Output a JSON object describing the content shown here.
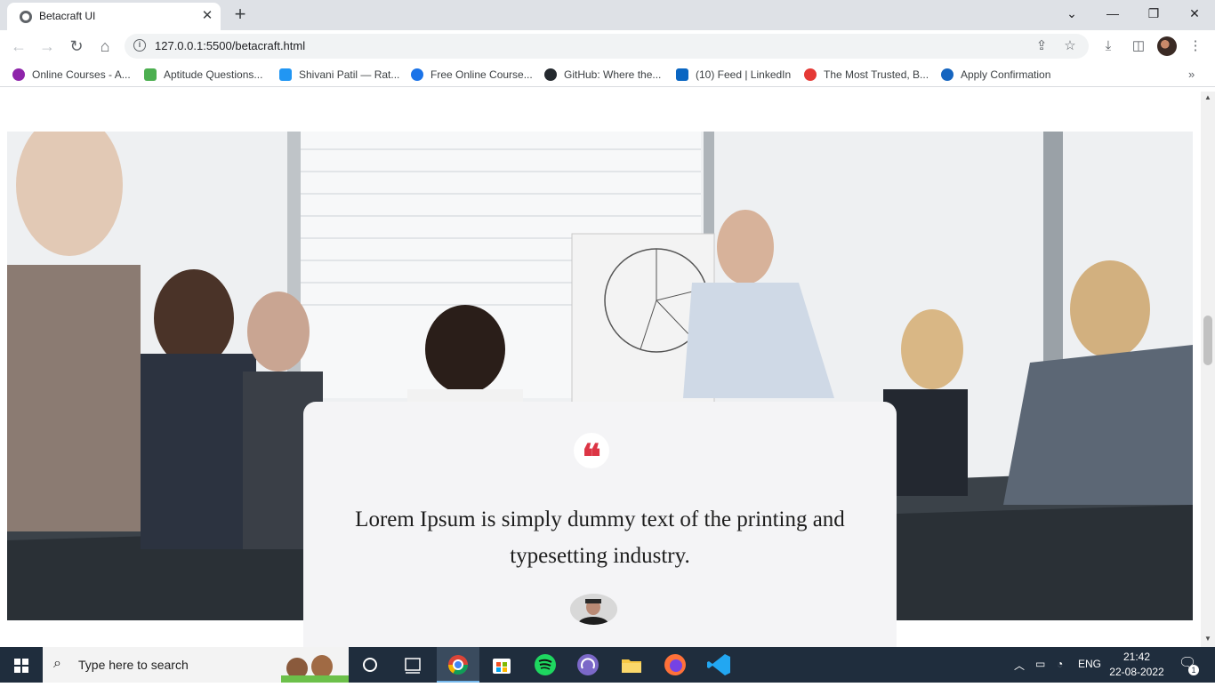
{
  "browser": {
    "tab_title": "Betacraft UI",
    "tab_close": "✕",
    "new_tab": "+",
    "url": "127.0.0.1:5500/betacraft.html",
    "window_controls": [
      "⌄",
      "—",
      "❐",
      "✕"
    ]
  },
  "bookmarks": [
    {
      "label": "Online Courses - A...",
      "color": "#8e24aa"
    },
    {
      "label": "Aptitude Questions...",
      "color": "#4caf50"
    },
    {
      "label": "Shivani Patil — Rat...",
      "color": "#2196f3"
    },
    {
      "label": "Free Online Course...",
      "color": "#1a73e8"
    },
    {
      "label": "GitHub: Where the...",
      "color": "#24292e"
    },
    {
      "label": "(10) Feed | LinkedIn",
      "color": "#0a66c2"
    },
    {
      "label": "The Most Trusted, B...",
      "color": "#e53935"
    },
    {
      "label": "Apply Confirmation",
      "color": "#1565c0"
    }
  ],
  "testimonial": {
    "quote_icon": "❝",
    "text": "Lorem Ipsum is simply dummy text of the printing and typesetting industry.",
    "accent_color": "#dc3545"
  },
  "taskbar": {
    "search_placeholder": "Type here to search",
    "language": "ENG",
    "time": "21:42",
    "date": "22-08-2022",
    "notification_count": "1"
  }
}
